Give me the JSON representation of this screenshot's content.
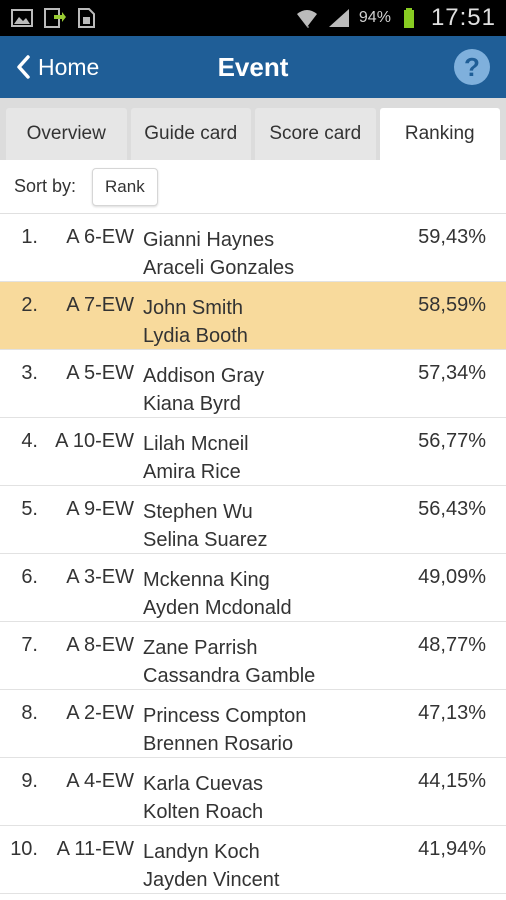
{
  "status_bar": {
    "left_icons": [
      "image-icon",
      "download-icon",
      "sim-card-icon"
    ],
    "battery_percent": "94%",
    "time": "17:51"
  },
  "app_bar": {
    "back_label": "Home",
    "title": "Event",
    "help_icon": "help-icon"
  },
  "tabs": [
    {
      "label": "Overview",
      "active": false
    },
    {
      "label": "Guide card",
      "active": false
    },
    {
      "label": "Score card",
      "active": false
    },
    {
      "label": "Ranking",
      "active": true
    }
  ],
  "sort": {
    "label": "Sort by:",
    "value": "Rank"
  },
  "colors": {
    "app_bar": "#1f5e97",
    "highlight_row": "#f8da9c",
    "tab_bg": "#e6e6e6"
  },
  "ranking": [
    {
      "rank": "1.",
      "team": "A 6-EW",
      "player1": "Gianni Haynes",
      "player2": "Araceli Gonzales",
      "score": "59,43%",
      "highlight": false
    },
    {
      "rank": "2.",
      "team": "A 7-EW",
      "player1": "John Smith",
      "player2": "Lydia Booth",
      "score": "58,59%",
      "highlight": true
    },
    {
      "rank": "3.",
      "team": "A 5-EW",
      "player1": "Addison Gray",
      "player2": "Kiana Byrd",
      "score": "57,34%",
      "highlight": false
    },
    {
      "rank": "4.",
      "team": "A 10-EW",
      "player1": "Lilah Mcneil",
      "player2": "Amira Rice",
      "score": "56,77%",
      "highlight": false
    },
    {
      "rank": "5.",
      "team": "A 9-EW",
      "player1": "Stephen Wu",
      "player2": "Selina Suarez",
      "score": "56,43%",
      "highlight": false
    },
    {
      "rank": "6.",
      "team": "A 3-EW",
      "player1": "Mckenna King",
      "player2": "Ayden Mcdonald",
      "score": "49,09%",
      "highlight": false
    },
    {
      "rank": "7.",
      "team": "A 8-EW",
      "player1": "Zane Parrish",
      "player2": "Cassandra Gamble",
      "score": "48,77%",
      "highlight": false
    },
    {
      "rank": "8.",
      "team": "A 2-EW",
      "player1": "Princess Compton",
      "player2": "Brennen Rosario",
      "score": "47,13%",
      "highlight": false
    },
    {
      "rank": "9.",
      "team": "A 4-EW",
      "player1": "Karla Cuevas",
      "player2": "Kolten Roach",
      "score": "44,15%",
      "highlight": false
    },
    {
      "rank": "10.",
      "team": "A 11-EW",
      "player1": "Landyn Koch",
      "player2": "Jayden Vincent",
      "score": "41,94%",
      "highlight": false
    }
  ]
}
